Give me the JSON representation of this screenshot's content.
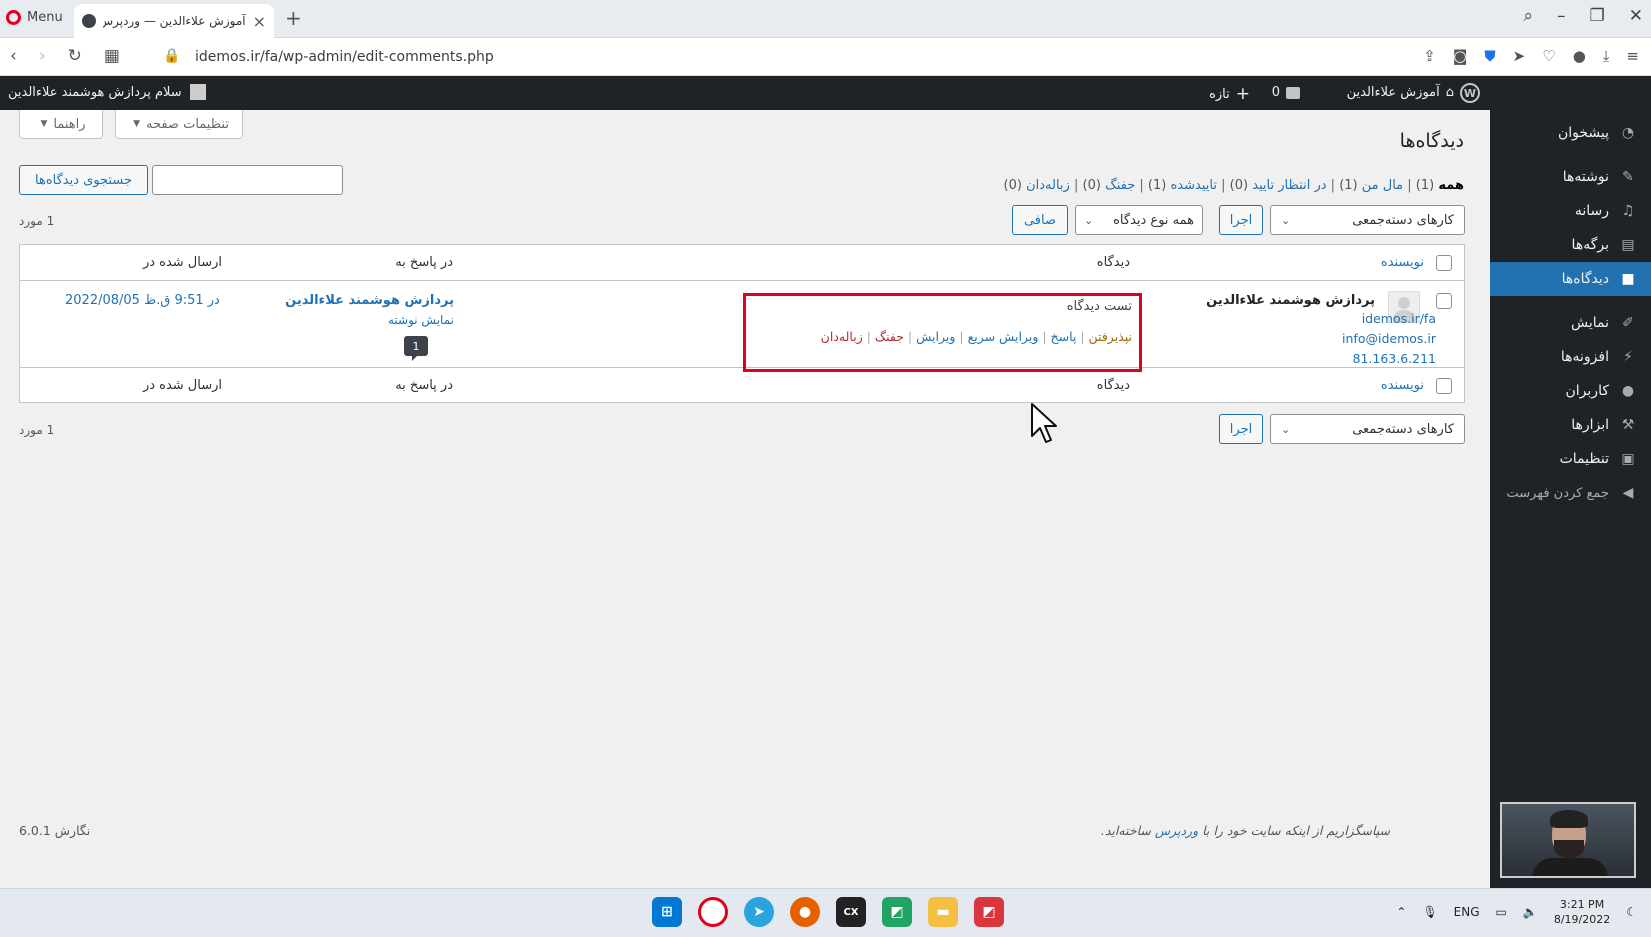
{
  "browser": {
    "menu_label": "Menu",
    "tab_title": "آموزش علاءالدین — وردپرس",
    "url": "idemos.ir/fa/wp-admin/edit-comments.php"
  },
  "adminbar": {
    "wp_logo": "W",
    "site_name": "آموزش علاءالدین",
    "comments_count": "0",
    "new_label": "تازه",
    "howdy": "سلام پردازش هوشمند علاءالدین"
  },
  "sidebar": {
    "items": [
      {
        "label": "پیشخوان",
        "icon": "dashboard-icon"
      },
      {
        "label": "نوشته‌ها",
        "icon": "pin-icon"
      },
      {
        "label": "رسانه",
        "icon": "media-icon"
      },
      {
        "label": "برگه‌ها",
        "icon": "page-icon"
      },
      {
        "label": "دیدگاه‌ها",
        "icon": "comment-icon"
      },
      {
        "label": "نمایش",
        "icon": "brush-icon"
      },
      {
        "label": "افزونه‌ها",
        "icon": "plugin-icon"
      },
      {
        "label": "کاربران",
        "icon": "users-icon"
      },
      {
        "label": "ابزارها",
        "icon": "wrench-icon"
      },
      {
        "label": "تنظیمات",
        "icon": "settings-icon"
      },
      {
        "label": "جمع کردن فهرست",
        "icon": "collapse-icon"
      }
    ]
  },
  "screen_tabs": {
    "help": "راهنما",
    "screen_options": "تنظیمات صفحه"
  },
  "page": {
    "title": "دیدگاه‌ها",
    "filters": {
      "all": "همه",
      "all_count": "(1)",
      "mine": "مال من",
      "mine_count": "(1)",
      "pending": "در انتظار تایید",
      "pending_count": "(0)",
      "approved": "تاییدشده",
      "approved_count": "(1)",
      "spam": "جفنگ",
      "spam_count": "(0)",
      "trash": "زباله‌دان",
      "trash_count": "(0)"
    },
    "search_button": "جستجوی دیدگاه‌ها",
    "search_value": "",
    "bulk_actions": "کارهای دسته‌جمعی",
    "apply": "اجرا",
    "comment_type": "همه نوع دیدگاه",
    "filter_button": "صافی",
    "items_count": "1 مورد"
  },
  "table": {
    "headers": {
      "author": "نویسنده",
      "comment": "دیدگاه",
      "in_response_to": "در پاسخ به",
      "submitted_on": "ارسال شده در"
    },
    "row": {
      "author_name": "پردازش هوشمند علاءالدین",
      "author_url": "idemos.ir/fa",
      "author_email": "info@idemos.ir",
      "author_ip": "81.163.6.211",
      "comment_text": "تست دیدگاه",
      "actions": {
        "approve": "نپذیرفتن",
        "reply": "پاسخ",
        "quick_edit": "ویرایش سریع",
        "edit": "ویرایش",
        "spam": "جفنگ",
        "trash": "زباله‌دان"
      },
      "post_title": "پردازش هوشمند علاءالدین",
      "view_post": "نمایش نوشته",
      "comment_bubble": "1",
      "date": "2022/08/05 در 9:51 ق.ظ"
    }
  },
  "footer": {
    "thanks_before": "سپاسگزاریم از اینکه سایت خود را با ",
    "thanks_link": "وردپرس",
    "thanks_after": " ساخته‌اید.",
    "version": "نگارش 6.0.1"
  },
  "taskbar": {
    "lang": "ENG",
    "time": "3:21 PM",
    "date": "8/19/2022"
  }
}
